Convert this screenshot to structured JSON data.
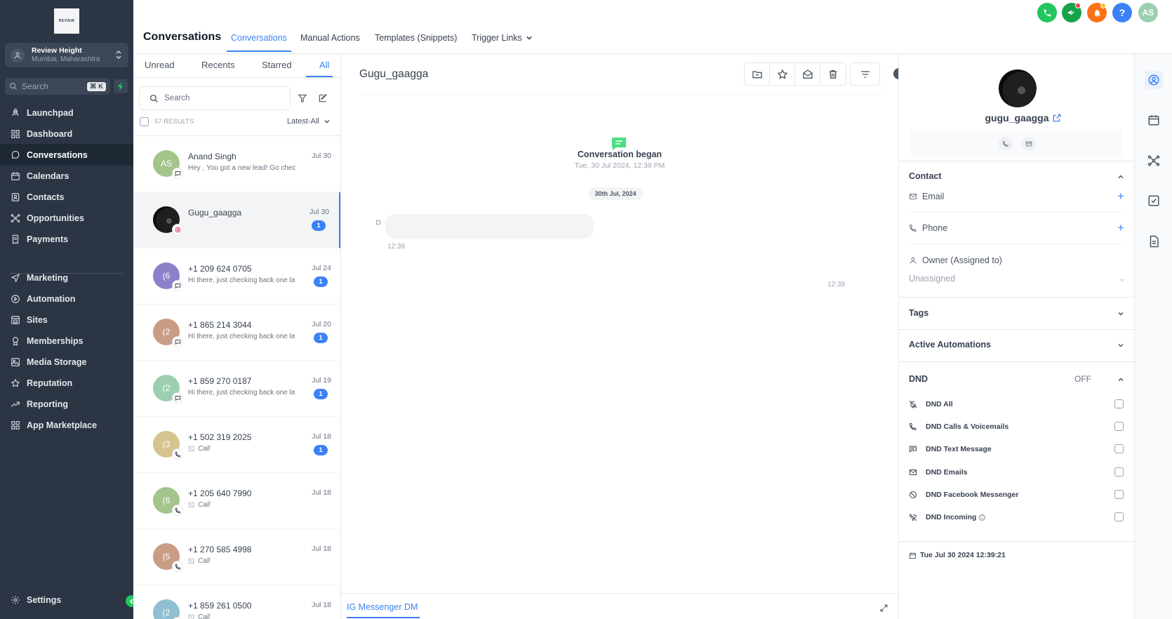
{
  "brand": {
    "logo_text": "REVIEW"
  },
  "account": {
    "name": "Review Height",
    "location": "Mumbai, Maharashtra"
  },
  "sidebar_search": {
    "placeholder": "Search",
    "shortcut": "⌘ K"
  },
  "nav": [
    {
      "label": "Launchpad",
      "icon": "rocket-icon"
    },
    {
      "label": "Dashboard",
      "icon": "grid-icon"
    },
    {
      "label": "Conversations",
      "icon": "chat-icon",
      "active": true
    },
    {
      "label": "Calendars",
      "icon": "calendar-icon"
    },
    {
      "label": "Contacts",
      "icon": "contacts-icon"
    },
    {
      "label": "Opportunities",
      "icon": "network-icon"
    },
    {
      "label": "Payments",
      "icon": "receipt-icon"
    },
    {
      "label": "Marketing",
      "icon": "send-icon"
    },
    {
      "label": "Automation",
      "icon": "automation-icon"
    },
    {
      "label": "Sites",
      "icon": "sites-icon"
    },
    {
      "label": "Memberships",
      "icon": "award-icon"
    },
    {
      "label": "Media Storage",
      "icon": "image-icon"
    },
    {
      "label": "Reputation",
      "icon": "star-icon"
    },
    {
      "label": "Reporting",
      "icon": "trend-icon"
    },
    {
      "label": "App Marketplace",
      "icon": "apps-icon"
    }
  ],
  "settings_label": "Settings",
  "header": {
    "title": "Conversations",
    "tabs": [
      "Conversations",
      "Manual Actions",
      "Templates (Snippets)",
      "Trigger Links"
    ],
    "user_initials": "AS",
    "colors": {
      "phone": "#22c55e",
      "megaphone": "#16a34a",
      "bell": "#f97316",
      "help": "#3b82f6",
      "user": "#9ccfb0"
    }
  },
  "list": {
    "tabs": [
      "Unread",
      "Recents",
      "Starred",
      "All"
    ],
    "search_placeholder": "Search",
    "results": "57 RESULTS",
    "sort": "Latest-All",
    "conversations": [
      {
        "initials": "AS",
        "name": "Anand Singh",
        "date": "Jul 30",
        "preview": "Hey , You got a new lead! Go chec",
        "color": "#a3c58c",
        "channel": "sms-icon"
      },
      {
        "initials": "",
        "name": "Gugu_gaagga",
        "date": "Jul 30",
        "preview": "",
        "count": "1",
        "color": "#111111",
        "channel": "instagram-icon",
        "selected": true
      },
      {
        "initials": "(6",
        "name": "+1 209 624 0705",
        "date": "Jul 24",
        "preview": "Hi there, just checking back one la",
        "count": "1",
        "color": "#8b80c9",
        "channel": "sms-icon"
      },
      {
        "initials": "(2",
        "name": "+1 865 214 3044",
        "date": "Jul 20",
        "preview": "Hi there, just checking back one la",
        "count": "1",
        "color": "#c99c86",
        "channel": "sms-icon"
      },
      {
        "initials": "(2",
        "name": "+1 859 270 0187",
        "date": "Jul 19",
        "preview": "Hi there, just checking back one la",
        "count": "1",
        "color": "#9ccfb0",
        "channel": "sms-icon"
      },
      {
        "initials": "(3",
        "name": "+1 502 319 2025",
        "date": "Jul 18",
        "preview": "Call",
        "count": "1",
        "color": "#d6c48f",
        "channel": "phone-icon"
      },
      {
        "initials": "(6",
        "name": "+1 205 640 7990",
        "date": "Jul 18",
        "preview": "Call",
        "color": "#a3c58c",
        "channel": "phone-icon"
      },
      {
        "initials": "(5",
        "name": "+1 270 585 4998",
        "date": "Jul 18",
        "preview": "Call",
        "color": "#c99c86",
        "channel": "phone-icon"
      },
      {
        "initials": "(2",
        "name": "+1 859 261 0500",
        "date": "Jul 18",
        "preview": "Call",
        "color": "#8fbfd0",
        "channel": "phone-icon"
      }
    ]
  },
  "chat": {
    "title": "Gugu_gaagga",
    "began_title": "Conversation began",
    "began_time": "Tue, 30 Jul 2024, 12:39 PM",
    "date_pill": "30th Jul, 2024",
    "msg_time": "12:39",
    "msg_time_right": "12:39",
    "composer_tab": "IG Messenger DM"
  },
  "contact": {
    "name": "gugu_gaagga",
    "section_contact": "Contact",
    "email_label": "Email",
    "phone_label": "Phone",
    "owner_label": "Owner (Assigned to)",
    "owner_value": "Unassigned",
    "tags_label": "Tags",
    "automations_label": "Active Automations",
    "dnd_label": "DND",
    "dnd_state": "OFF",
    "dnd_options": [
      "DND All",
      "DND Calls & Voicemails",
      "DND Text Message",
      "DND Emails",
      "DND Facebook Messenger",
      "DND Incoming"
    ],
    "created": "Tue Jul 30 2024 12:39:21"
  }
}
